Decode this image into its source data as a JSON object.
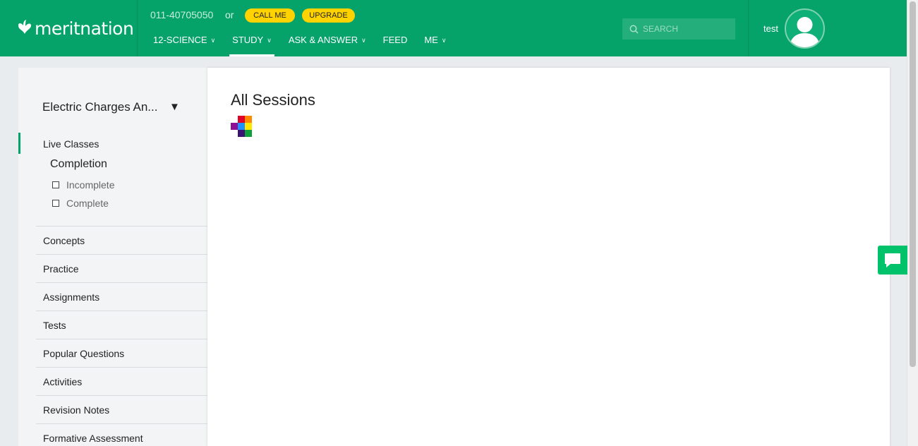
{
  "header": {
    "logo_text": "meritnation",
    "phone": "011-40705050",
    "or_text": "or",
    "call_me_label": "CALL ME",
    "upgrade_label": "UPGRADE",
    "nav": [
      {
        "label": "12-SCIENCE",
        "has_dropdown": true
      },
      {
        "label": "STUDY",
        "has_dropdown": true,
        "active": true
      },
      {
        "label": "ASK & ANSWER",
        "has_dropdown": true
      },
      {
        "label": "FEED",
        "has_dropdown": false
      },
      {
        "label": "ME",
        "has_dropdown": true
      }
    ],
    "search_placeholder": "SEARCH",
    "username": "test",
    "colors": {
      "brand": "#05a36a",
      "pill": "#ffd200"
    }
  },
  "sidebar": {
    "chapter": "Electric Charges An...",
    "live_classes": "Live Classes",
    "completion_label": "Completion",
    "completion_options": [
      "Incomplete",
      "Complete"
    ],
    "menu": [
      "Concepts",
      "Practice",
      "Assignments",
      "Tests",
      "Popular Questions",
      "Activities",
      "Revision Notes",
      "Formative Assessment"
    ]
  },
  "main": {
    "title": "All Sessions"
  },
  "icons": {
    "logo": "butterfly-icon",
    "search": "search-icon",
    "avatar": "user-avatar-icon",
    "chat": "chat-bubble-icon",
    "dropdown": "chevron-down-icon",
    "chapter_toggle": "triangle-down-icon"
  }
}
